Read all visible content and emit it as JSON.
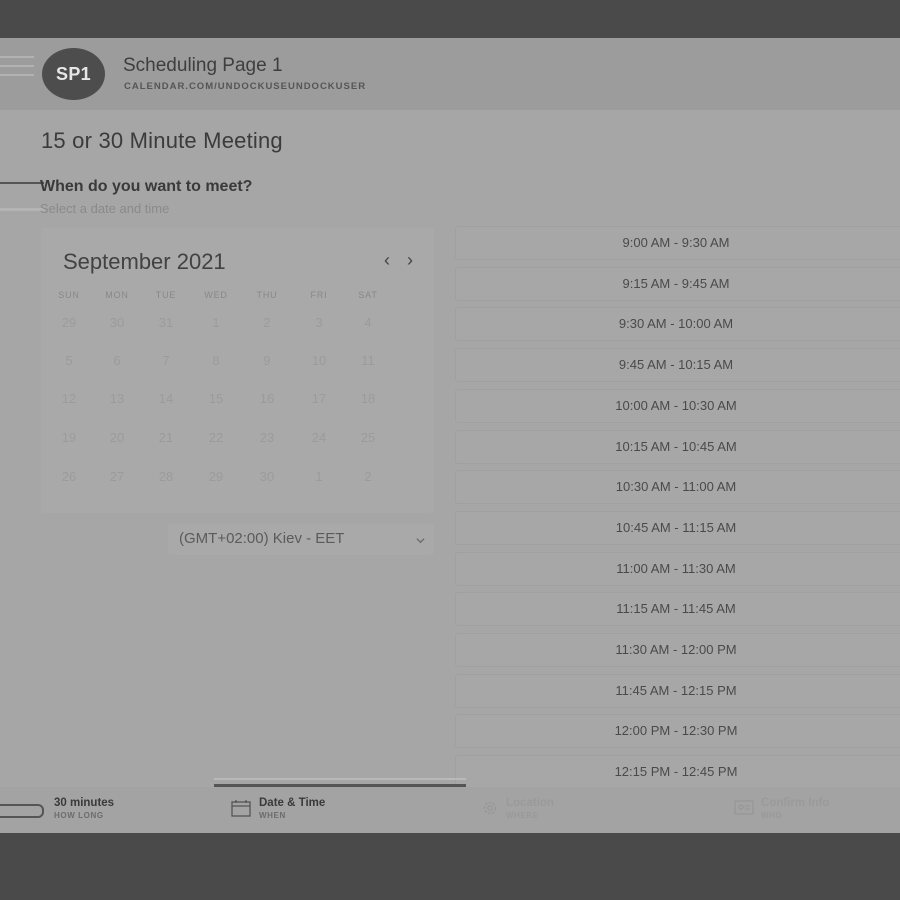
{
  "header": {
    "avatar": "SP1",
    "title": "Scheduling Page 1",
    "url": "CALENDAR.COM/UNDOCKUSEUNDOCKUSER"
  },
  "meeting": {
    "title": "15 or 30 Minute Meeting",
    "question": "When do you want to meet?",
    "subtitle": "Select a date and time"
  },
  "calendar": {
    "month": "September 2021",
    "prev": "‹",
    "next": "›",
    "weekdays": [
      "SUN",
      "MON",
      "TUE",
      "WED",
      "THU",
      "FRI",
      "SAT"
    ],
    "weeks": [
      [
        "29",
        "30",
        "31",
        "1",
        "2",
        "3",
        "4"
      ],
      [
        "5",
        "6",
        "7",
        "8",
        "9",
        "10",
        "11"
      ],
      [
        "12",
        "13",
        "14",
        "15",
        "16",
        "17",
        "18"
      ],
      [
        "19",
        "20",
        "21",
        "22",
        "23",
        "24",
        "25"
      ],
      [
        "26",
        "27",
        "28",
        "29",
        "30",
        "1",
        "2"
      ]
    ]
  },
  "timezone": {
    "label": "(GMT+02:00) Kiev - EET"
  },
  "slots": [
    "9:00 AM - 9:30 AM",
    "9:15 AM - 9:45 AM",
    "9:30 AM - 10:00 AM",
    "9:45 AM - 10:15 AM",
    "10:00 AM - 10:30 AM",
    "10:15 AM - 10:45 AM",
    "10:30 AM - 11:00 AM",
    "10:45 AM - 11:15 AM",
    "11:00 AM - 11:30 AM",
    "11:15 AM - 11:45 AM",
    "11:30 AM - 12:00 PM",
    "11:45 AM - 12:15 PM",
    "12:00 PM - 12:30 PM",
    "12:15 PM - 12:45 PM"
  ],
  "steps": [
    {
      "label": "30 minutes",
      "sub": "HOW LONG",
      "icon": "clock-icon"
    },
    {
      "label": "Date & Time",
      "sub": "WHEN",
      "icon": "calendar-icon"
    },
    {
      "label": "Location",
      "sub": "WHERE",
      "icon": "gear-icon"
    },
    {
      "label": "Confirm Info",
      "sub": "WHO",
      "icon": "id-card-icon"
    }
  ]
}
